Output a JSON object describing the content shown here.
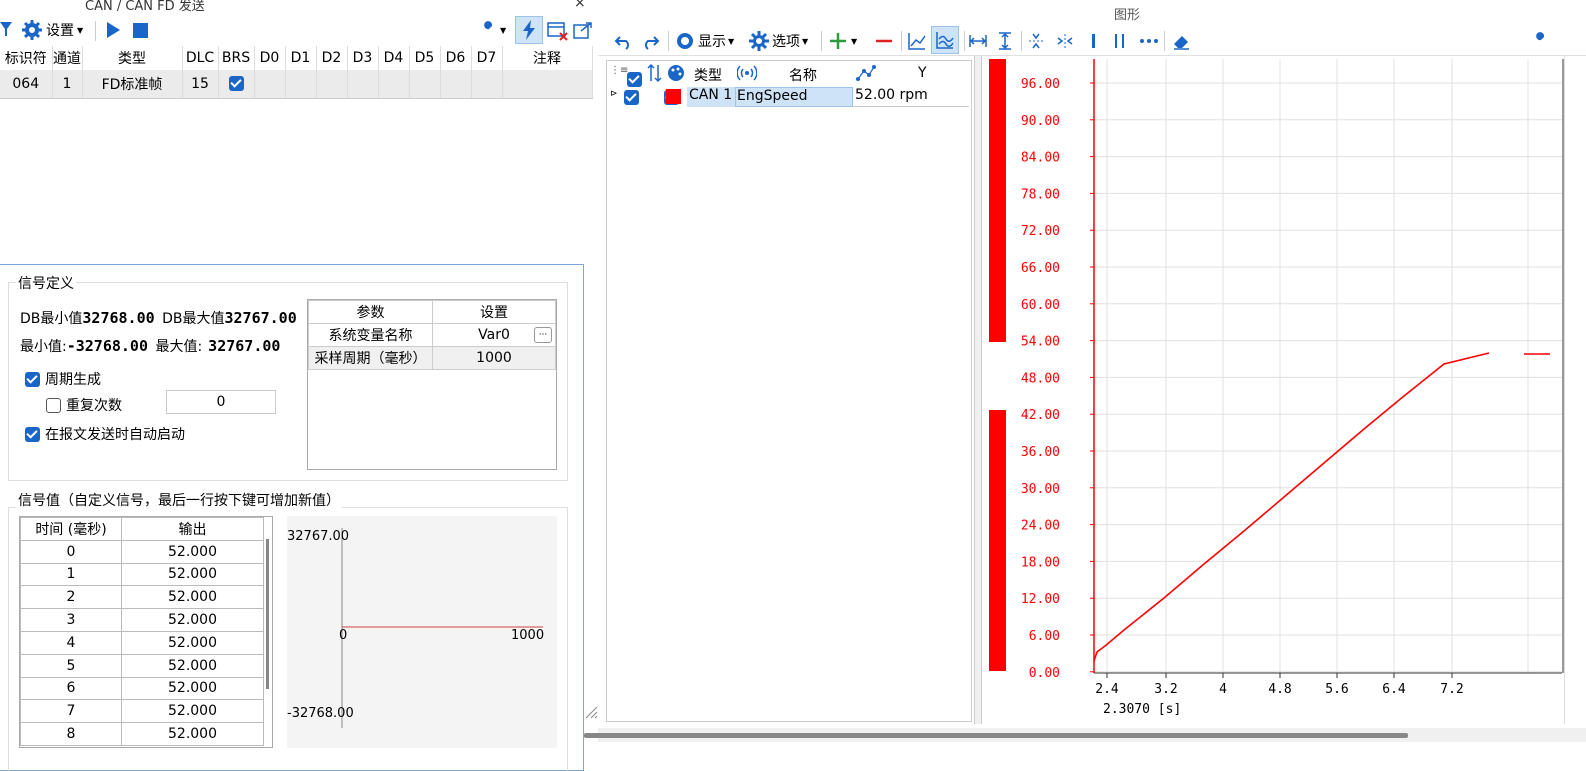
{
  "left_window": {
    "title": "CAN / CAN FD 发送",
    "close": "×",
    "toolbar": {
      "settings_label": "设置"
    },
    "message_table": {
      "headers": [
        "标识符",
        "通道",
        "类型",
        "DLC",
        "BRS",
        "D0",
        "D1",
        "D2",
        "D3",
        "D4",
        "D5",
        "D6",
        "D7",
        "注释"
      ],
      "row": {
        "id": "064",
        "channel": "1",
        "type": "FD标准帧",
        "dlc": "15",
        "brs": true
      }
    },
    "signal_def": {
      "legend": "信号定义",
      "db_min_label": "DB最小值",
      "db_min": "32768.00",
      "db_max_label": "DB最大值",
      "db_max": "32767.00",
      "min_label": "最小值:",
      "min": "-32768.00",
      "max_label": "最大值:",
      "max": "32767.00",
      "periodic": "周期生成",
      "repeat": "重复次数",
      "repeat_value": "0",
      "autostart": "在报文发送时自动启动",
      "params": {
        "header_param": "参数",
        "header_setting": "设置",
        "rows": [
          {
            "name": "系统变量名称",
            "value": "Var0",
            "ellipsis": "···"
          },
          {
            "name": "采样周期（毫秒）",
            "value": "1000"
          }
        ]
      }
    },
    "signal_values": {
      "legend": "信号值（自定义信号，最后一行按下键可增加新值）",
      "col_time": "时间 (毫秒)",
      "col_output": "输出",
      "rows": [
        {
          "t": "0",
          "v": "52.000"
        },
        {
          "t": "1",
          "v": "52.000"
        },
        {
          "t": "2",
          "v": "52.000"
        },
        {
          "t": "3",
          "v": "52.000"
        },
        {
          "t": "4",
          "v": "52.000"
        },
        {
          "t": "5",
          "v": "52.000"
        },
        {
          "t": "6",
          "v": "52.000"
        },
        {
          "t": "7",
          "v": "52.000"
        },
        {
          "t": "8",
          "v": "52.000"
        }
      ],
      "preview": {
        "y_top": "32767.00",
        "y_bottom": "-32768.00",
        "x_left": "0",
        "x_right": "1000"
      }
    }
  },
  "right_window": {
    "title": "图形",
    "toolbar": {
      "display": "显示",
      "options": "选项"
    },
    "signal_list": {
      "headers": {
        "type": "类型",
        "name": "名称",
        "y": "Y"
      },
      "row": {
        "type": "CAN 1",
        "name": "EngSpeed",
        "value": "52.00 rpm",
        "color": "#ff0000"
      }
    },
    "graph": {
      "y_ticks": [
        "96.00",
        "90.00",
        "84.00",
        "78.00",
        "72.00",
        "66.00",
        "60.00",
        "54.00",
        "48.00",
        "42.00",
        "36.00",
        "30.00",
        "24.00",
        "18.00",
        "12.00",
        "6.00",
        "0.00"
      ],
      "x_ticks": [
        "2.4",
        "3.2",
        "4",
        "4.8",
        "5.6",
        "6.4",
        "7.2"
      ],
      "x_readout": "2.3070 [s]",
      "line_color": "#ff0000"
    }
  }
}
